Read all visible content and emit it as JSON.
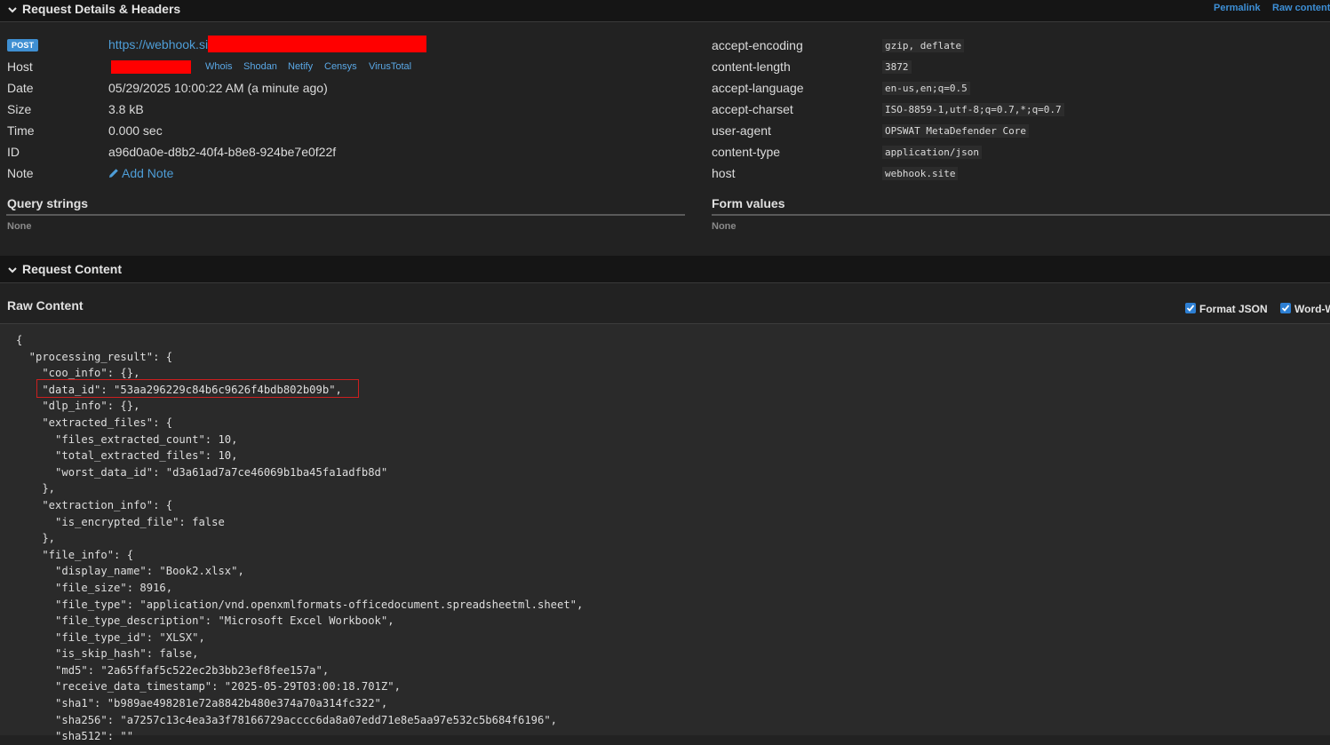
{
  "header": {
    "title": "Request Details & Headers",
    "permalink": "Permalink",
    "raw_content": "Raw content"
  },
  "details": {
    "method": "POST",
    "url": "https://webhook.site",
    "host_label": "Host",
    "host_links": [
      "Whois",
      "Shodan",
      "Netify",
      "Censys",
      "VirusTotal"
    ],
    "date_label": "Date",
    "date_value": "05/29/2025 10:00:22 AM (a minute ago)",
    "size_label": "Size",
    "size_value": "3.8 kB",
    "time_label": "Time",
    "time_value": "0.000 sec",
    "id_label": "ID",
    "id_value": "a96d0a0e-d8b2-40f4-b8e8-924be7e0f22f",
    "note_label": "Note",
    "add_note": "Add Note"
  },
  "headers": [
    {
      "name": "accept-encoding",
      "value": "gzip, deflate"
    },
    {
      "name": "content-length",
      "value": "3872"
    },
    {
      "name": "accept-language",
      "value": "en-us,en;q=0.5"
    },
    {
      "name": "accept-charset",
      "value": "ISO-8859-1,utf-8;q=0.7,*;q=0.7"
    },
    {
      "name": "user-agent",
      "value": "OPSWAT MetaDefender Core"
    },
    {
      "name": "content-type",
      "value": "application/json"
    },
    {
      "name": "host",
      "value": "webhook.site"
    }
  ],
  "query_strings": {
    "title": "Query strings",
    "empty": "None"
  },
  "form_values": {
    "title": "Form values",
    "empty": "None"
  },
  "content": {
    "title": "Request Content",
    "raw_title": "Raw Content",
    "format_json": "Format JSON",
    "word_wrap": "Word-W"
  },
  "raw_lines": [
    "{",
    "  \"processing_result\": {",
    "    \"coo_info\": {},",
    "    \"data_id\": \"53aa296229c84b6c9626f4bdb802b09b\",",
    "    \"dlp_info\": {},",
    "    \"extracted_files\": {",
    "      \"files_extracted_count\": 10,",
    "      \"total_extracted_files\": 10,",
    "      \"worst_data_id\": \"d3a61ad7a7ce46069b1ba45fa1adfb8d\"",
    "    },",
    "    \"extraction_info\": {",
    "      \"is_encrypted_file\": false",
    "    },",
    "    \"file_info\": {",
    "      \"display_name\": \"Book2.xlsx\",",
    "      \"file_size\": 8916,",
    "      \"file_type\": \"application/vnd.openxmlformats-officedocument.spreadsheetml.sheet\",",
    "      \"file_type_description\": \"Microsoft Excel Workbook\",",
    "      \"file_type_id\": \"XLSX\",",
    "      \"is_skip_hash\": false,",
    "      \"md5\": \"2a65ffaf5c522ec2b3bb23ef8fee157a\",",
    "      \"receive_data_timestamp\": \"2025-05-29T03:00:18.701Z\",",
    "      \"sha1\": \"b989ae498281e72a8842b480e374a70a314fc322\",",
    "      \"sha256\": \"a7257c13c4ea3a3f78166729acccc6da8a07edd71e8e5aa97e532c5b684f6196\",",
    "      \"sha512\": \"\""
  ]
}
